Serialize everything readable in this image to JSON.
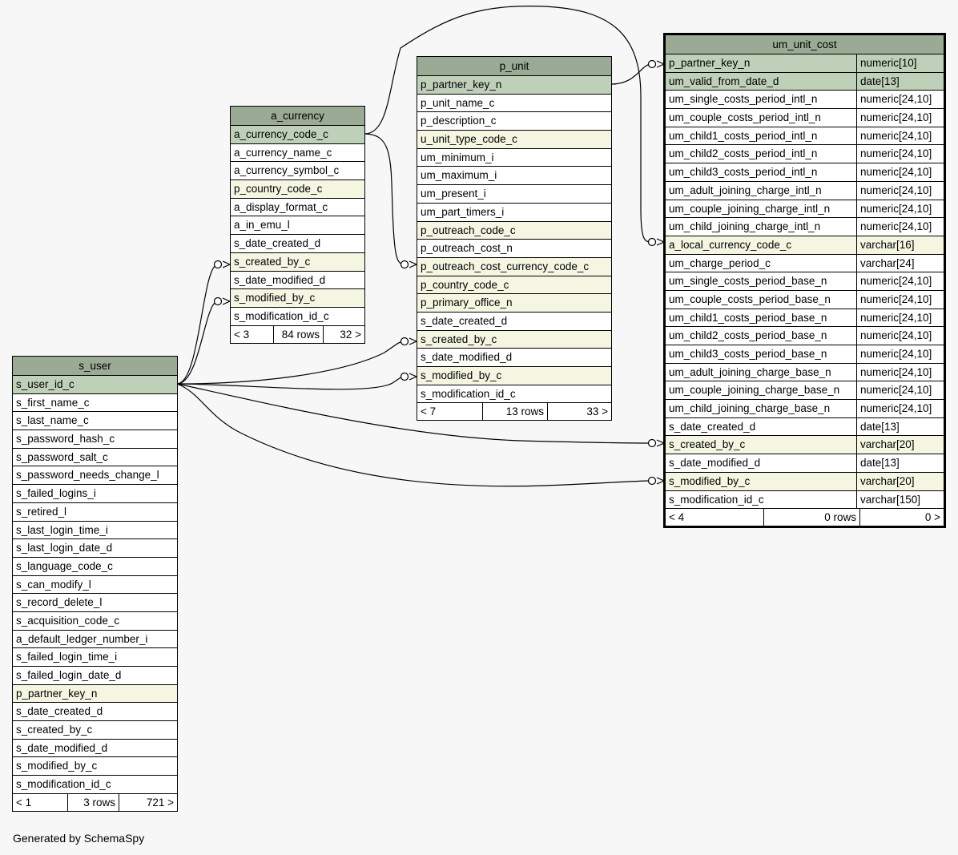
{
  "tables": {
    "a_currency": {
      "name": "a_currency",
      "columns": [
        {
          "name": "a_currency_code_c",
          "kind": "pk"
        },
        {
          "name": "a_currency_name_c",
          "kind": "normal"
        },
        {
          "name": "a_currency_symbol_c",
          "kind": "normal"
        },
        {
          "name": "p_country_code_c",
          "kind": "fk"
        },
        {
          "name": "a_display_format_c",
          "kind": "normal"
        },
        {
          "name": "a_in_emu_l",
          "kind": "normal"
        },
        {
          "name": "s_date_created_d",
          "kind": "normal"
        },
        {
          "name": "s_created_by_c",
          "kind": "fk"
        },
        {
          "name": "s_date_modified_d",
          "kind": "normal"
        },
        {
          "name": "s_modified_by_c",
          "kind": "fk"
        },
        {
          "name": "s_modification_id_c",
          "kind": "normal"
        }
      ],
      "footer": [
        "< 3",
        "84 rows",
        "32 >"
      ]
    },
    "p_unit": {
      "name": "p_unit",
      "columns": [
        {
          "name": "p_partner_key_n",
          "kind": "pk"
        },
        {
          "name": "p_unit_name_c",
          "kind": "normal"
        },
        {
          "name": "p_description_c",
          "kind": "normal"
        },
        {
          "name": "u_unit_type_code_c",
          "kind": "fk"
        },
        {
          "name": "um_minimum_i",
          "kind": "normal"
        },
        {
          "name": "um_maximum_i",
          "kind": "normal"
        },
        {
          "name": "um_present_i",
          "kind": "normal"
        },
        {
          "name": "um_part_timers_i",
          "kind": "normal"
        },
        {
          "name": "p_outreach_code_c",
          "kind": "fk"
        },
        {
          "name": "p_outreach_cost_n",
          "kind": "normal"
        },
        {
          "name": "p_outreach_cost_currency_code_c",
          "kind": "fk"
        },
        {
          "name": "p_country_code_c",
          "kind": "fk"
        },
        {
          "name": "p_primary_office_n",
          "kind": "fk"
        },
        {
          "name": "s_date_created_d",
          "kind": "normal"
        },
        {
          "name": "s_created_by_c",
          "kind": "fk"
        },
        {
          "name": "s_date_modified_d",
          "kind": "normal"
        },
        {
          "name": "s_modified_by_c",
          "kind": "fk"
        },
        {
          "name": "s_modification_id_c",
          "kind": "normal"
        }
      ],
      "footer": [
        "< 7",
        "13 rows",
        "33 >"
      ]
    },
    "um_unit_cost": {
      "name": "um_unit_cost",
      "columns": [
        {
          "name": "p_partner_key_n",
          "type": "numeric[10]",
          "kind": "pk"
        },
        {
          "name": "um_valid_from_date_d",
          "type": "date[13]",
          "kind": "pk"
        },
        {
          "name": "um_single_costs_period_intl_n",
          "type": "numeric[24,10]",
          "kind": "normal"
        },
        {
          "name": "um_couple_costs_period_intl_n",
          "type": "numeric[24,10]",
          "kind": "normal"
        },
        {
          "name": "um_child1_costs_period_intl_n",
          "type": "numeric[24,10]",
          "kind": "normal"
        },
        {
          "name": "um_child2_costs_period_intl_n",
          "type": "numeric[24,10]",
          "kind": "normal"
        },
        {
          "name": "um_child3_costs_period_intl_n",
          "type": "numeric[24,10]",
          "kind": "normal"
        },
        {
          "name": "um_adult_joining_charge_intl_n",
          "type": "numeric[24,10]",
          "kind": "normal"
        },
        {
          "name": "um_couple_joining_charge_intl_n",
          "type": "numeric[24,10]",
          "kind": "normal"
        },
        {
          "name": "um_child_joining_charge_intl_n",
          "type": "numeric[24,10]",
          "kind": "normal"
        },
        {
          "name": "a_local_currency_code_c",
          "type": "varchar[16]",
          "kind": "fk"
        },
        {
          "name": "um_charge_period_c",
          "type": "varchar[24]",
          "kind": "normal"
        },
        {
          "name": "um_single_costs_period_base_n",
          "type": "numeric[24,10]",
          "kind": "normal"
        },
        {
          "name": "um_couple_costs_period_base_n",
          "type": "numeric[24,10]",
          "kind": "normal"
        },
        {
          "name": "um_child1_costs_period_base_n",
          "type": "numeric[24,10]",
          "kind": "normal"
        },
        {
          "name": "um_child2_costs_period_base_n",
          "type": "numeric[24,10]",
          "kind": "normal"
        },
        {
          "name": "um_child3_costs_period_base_n",
          "type": "numeric[24,10]",
          "kind": "normal"
        },
        {
          "name": "um_adult_joining_charge_base_n",
          "type": "numeric[24,10]",
          "kind": "normal"
        },
        {
          "name": "um_couple_joining_charge_base_n",
          "type": "numeric[24,10]",
          "kind": "normal"
        },
        {
          "name": "um_child_joining_charge_base_n",
          "type": "numeric[24,10]",
          "kind": "normal"
        },
        {
          "name": "s_date_created_d",
          "type": "date[13]",
          "kind": "normal"
        },
        {
          "name": "s_created_by_c",
          "type": "varchar[20]",
          "kind": "fk"
        },
        {
          "name": "s_date_modified_d",
          "type": "date[13]",
          "kind": "normal"
        },
        {
          "name": "s_modified_by_c",
          "type": "varchar[20]",
          "kind": "fk"
        },
        {
          "name": "s_modification_id_c",
          "type": "varchar[150]",
          "kind": "normal"
        }
      ],
      "footer": [
        "< 4",
        "0 rows",
        "0 >"
      ]
    },
    "s_user": {
      "name": "s_user",
      "columns": [
        {
          "name": "s_user_id_c",
          "kind": "pk"
        },
        {
          "name": "s_first_name_c",
          "kind": "normal"
        },
        {
          "name": "s_last_name_c",
          "kind": "normal"
        },
        {
          "name": "s_password_hash_c",
          "kind": "normal"
        },
        {
          "name": "s_password_salt_c",
          "kind": "normal"
        },
        {
          "name": "s_password_needs_change_l",
          "kind": "normal"
        },
        {
          "name": "s_failed_logins_i",
          "kind": "normal"
        },
        {
          "name": "s_retired_l",
          "kind": "normal"
        },
        {
          "name": "s_last_login_time_i",
          "kind": "normal"
        },
        {
          "name": "s_last_login_date_d",
          "kind": "normal"
        },
        {
          "name": "s_language_code_c",
          "kind": "normal"
        },
        {
          "name": "s_can_modify_l",
          "kind": "normal"
        },
        {
          "name": "s_record_delete_l",
          "kind": "normal"
        },
        {
          "name": "s_acquisition_code_c",
          "kind": "normal"
        },
        {
          "name": "a_default_ledger_number_i",
          "kind": "normal"
        },
        {
          "name": "s_failed_login_time_i",
          "kind": "normal"
        },
        {
          "name": "s_failed_login_date_d",
          "kind": "normal"
        },
        {
          "name": "p_partner_key_n",
          "kind": "fk"
        },
        {
          "name": "s_date_created_d",
          "kind": "normal"
        },
        {
          "name": "s_created_by_c",
          "kind": "normal"
        },
        {
          "name": "s_date_modified_d",
          "kind": "normal"
        },
        {
          "name": "s_modified_by_c",
          "kind": "normal"
        },
        {
          "name": "s_modification_id_c",
          "kind": "normal"
        }
      ],
      "footer": [
        "< 1",
        "3 rows",
        "721 >"
      ]
    }
  },
  "generated_by": "Generated by SchemaSpy",
  "colors": {
    "header": "#9aaa94",
    "primary_key": "#bfd0b9",
    "foreign_key": "#f4f6e2",
    "background": "#f7f7f7"
  }
}
